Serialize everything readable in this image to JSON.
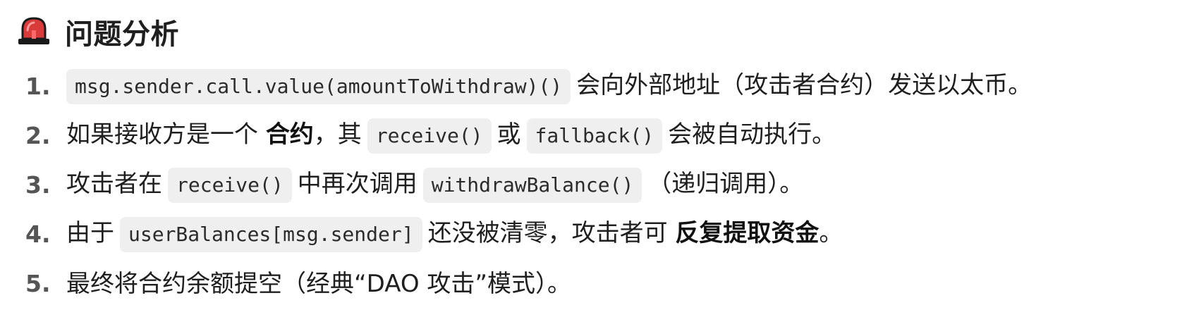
{
  "heading": {
    "icon": "siren-icon",
    "title": "问题分析"
  },
  "colors": {
    "siren_red": "#d93a3a",
    "siren_dark": "#1a1a1a",
    "code_bg": "#efefef",
    "number_gray": "#555555"
  },
  "items": [
    {
      "number": "1.",
      "code_1": "msg.sender.call.value(amountToWithdraw)()",
      "text_1": "会向外部地址（攻击者合约）发送以太币。"
    },
    {
      "number": "2.",
      "text_1": "如果接收方是一个 ",
      "bold_1": "合约",
      "text_2": "，其",
      "code_1": "receive()",
      "text_3": "或",
      "code_2": "fallback()",
      "text_4": "会被自动执行。"
    },
    {
      "number": "3.",
      "text_1": "攻击者在",
      "code_1": "receive()",
      "text_2": "中再次调用",
      "code_2": "withdrawBalance()",
      "text_3": "（递归调用）。"
    },
    {
      "number": "4.",
      "text_1": "由于",
      "code_1": "userBalances[msg.sender]",
      "text_2": "还没被清零，攻击者可 ",
      "bold_1": "反复提取资金",
      "text_3": "。"
    },
    {
      "number": "5.",
      "text_1": "最终将合约余额提空（经典“DAO 攻击”模式）。"
    }
  ]
}
